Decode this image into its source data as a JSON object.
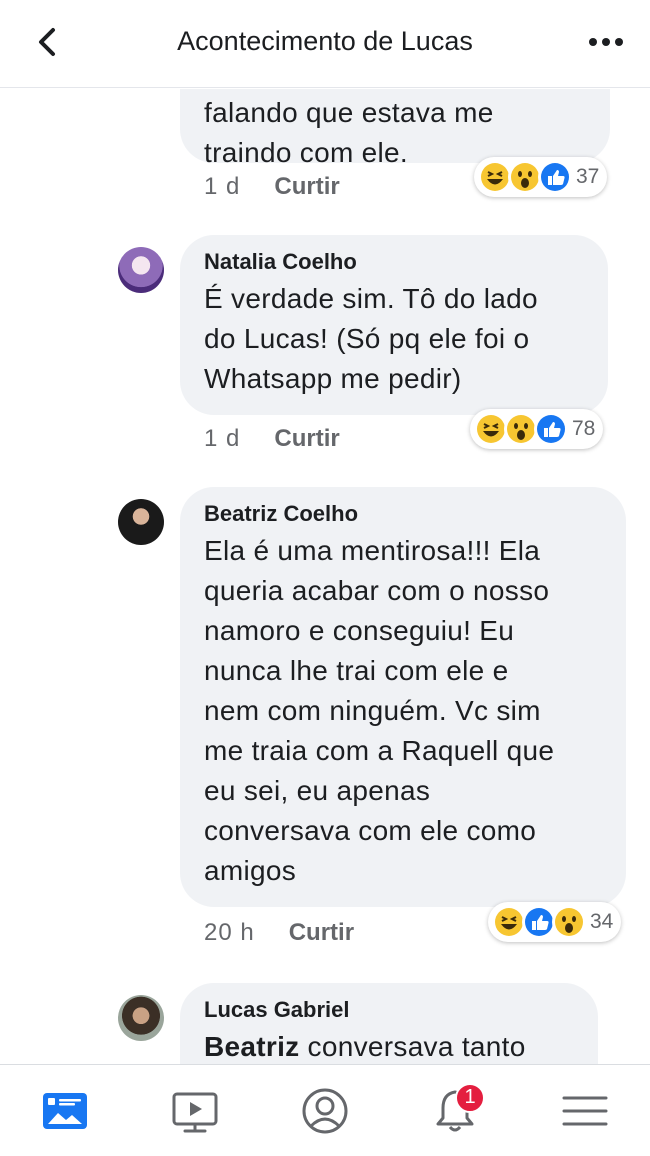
{
  "header": {
    "title": "Acontecimento de Lucas"
  },
  "comments": [
    {
      "name": "",
      "lines": [
        "falando que estava me",
        "traindo com ele."
      ],
      "time": "1 d",
      "like_label": "Curtir",
      "reaction_icons": [
        "haha-icon",
        "wow-icon",
        "like-icon"
      ],
      "reaction_count": "37"
    },
    {
      "name": "Natalia Coelho",
      "lines": [
        "É verdade sim. Tô do lado",
        "do Lucas! (Só pq ele foi o",
        "Whatsapp me pedir)"
      ],
      "time": "1 d",
      "like_label": "Curtir",
      "reaction_icons": [
        "haha-icon",
        "wow-icon",
        "like-icon"
      ],
      "reaction_count": "78"
    },
    {
      "name": "Beatriz Coelho",
      "lines": [
        "Ela é uma mentirosa!!! Ela",
        "queria acabar com o nosso",
        "namoro e conseguiu! Eu",
        "nunca lhe trai com ele e",
        "nem com ninguém. Vc sim",
        "me traia com a Raquell que",
        "eu sei, eu apenas",
        "conversava com ele como",
        "amigos"
      ],
      "time": "20 h",
      "like_label": "Curtir",
      "reaction_icons": [
        "haha-icon",
        "like-icon",
        "wow-icon"
      ],
      "reaction_count": "34"
    },
    {
      "name": "Lucas Gabriel",
      "mention": "Beatriz",
      "lines_rest": " conversava tanto"
    }
  ],
  "bottom_nav": {
    "items": [
      "news-feed-icon",
      "watch-icon",
      "profile-icon",
      "notifications-icon",
      "menu-icon"
    ],
    "notifications_badge": "1"
  },
  "colors": {
    "accent": "#1877f2",
    "bubble": "#f0f2f5",
    "badge": "#e41e3f",
    "reaction_yellow": "#f7c631"
  }
}
